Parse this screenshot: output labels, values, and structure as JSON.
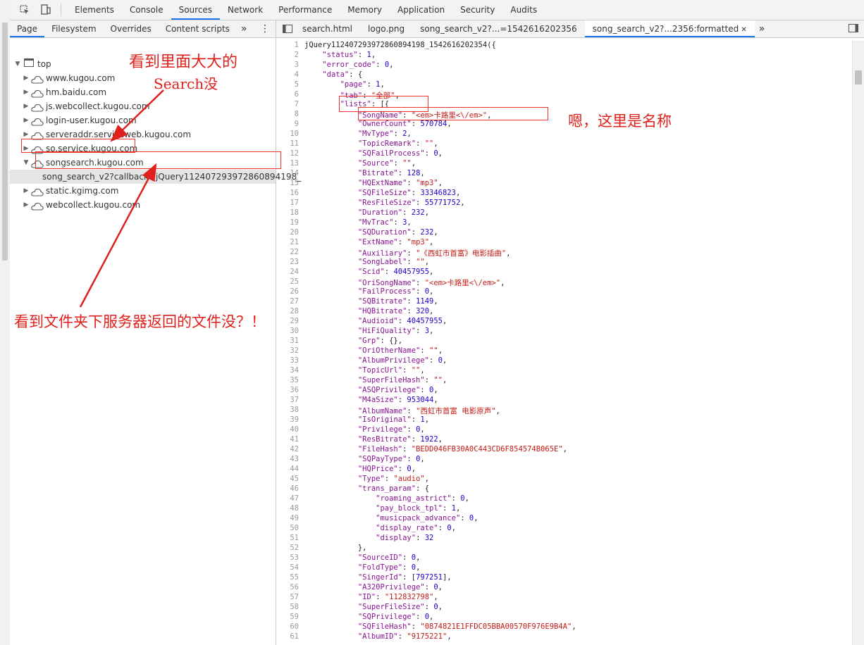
{
  "main_tabs": [
    "Elements",
    "Console",
    "Sources",
    "Network",
    "Performance",
    "Memory",
    "Application",
    "Security",
    "Audits"
  ],
  "main_tab_active": "Sources",
  "navigator": {
    "tabs": [
      "Page",
      "Filesystem",
      "Overrides",
      "Content scripts"
    ],
    "active": "Page",
    "more_glyph": "»",
    "menu_glyph": "⋮",
    "tree": [
      {
        "label": "top",
        "icon": "frame-icon",
        "expanded": true
      },
      {
        "label": "www.kugou.com",
        "icon": "cloud-icon"
      },
      {
        "label": "hm.baidu.com",
        "icon": "cloud-icon"
      },
      {
        "label": "js.webcollect.kugou.com",
        "icon": "cloud-icon"
      },
      {
        "label": "login-user.kugou.com",
        "icon": "cloud-icon"
      },
      {
        "label": "serveraddr.serviceweb.kugou.com",
        "icon": "cloud-icon"
      },
      {
        "label": "so.service.kugou.com",
        "icon": "cloud-icon"
      },
      {
        "label": "songsearch.kugou.com",
        "icon": "cloud-icon",
        "expanded": true
      },
      {
        "label": "song_search_v2?callback=jQuery112407293972860894198_",
        "icon": "folder-icon",
        "selected": true
      },
      {
        "label": "static.kgimg.com",
        "icon": "cloud-icon"
      },
      {
        "label": "webcollect.kugou.com",
        "icon": "cloud-icon"
      }
    ]
  },
  "editor_tabs": [
    "search.html",
    "logo.png",
    "song_search_v2?...=1542616202356",
    "song_search_v2?...2356:formatted"
  ],
  "editor_active": "song_search_v2?...2356:formatted",
  "code_lines": [
    "jQuery112407293972860894198_1542616202354({",
    "    \"status\": 1,",
    "    \"error_code\": 0,",
    "    \"data\": {",
    "        \"page\": 1,",
    "        \"tab\": \"全部\",",
    "        \"lists\": [{",
    "            \"SongName\": \"<em>卡路里<\\/em>\",",
    "            \"OwnerCount\": 570784,",
    "            \"MvType\": 2,",
    "            \"TopicRemark\": \"\",",
    "            \"SQFailProcess\": 0,",
    "            \"Source\": \"\",",
    "            \"Bitrate\": 128,",
    "            \"HQExtName\": \"mp3\",",
    "            \"SQFileSize\": 33346823,",
    "            \"ResFileSize\": 55771752,",
    "            \"Duration\": 232,",
    "            \"MvTrac\": 3,",
    "            \"SQDuration\": 232,",
    "            \"ExtName\": \"mp3\",",
    "            \"Auxiliary\": \"《西虹市首富》电影插曲\",",
    "            \"SongLabel\": \"\",",
    "            \"Scid\": 40457955,",
    "            \"OriSongName\": \"<em>卡路里<\\/em>\",",
    "            \"FailProcess\": 0,",
    "            \"SQBitrate\": 1149,",
    "            \"HQBitrate\": 320,",
    "            \"Audioid\": 40457955,",
    "            \"HiFiQuality\": 3,",
    "            \"Grp\": {},",
    "            \"OriOtherName\": \"\",",
    "            \"AlbumPrivilege\": 0,",
    "            \"TopicUrl\": \"\",",
    "            \"SuperFileHash\": \"\",",
    "            \"ASQPrivilege\": 0,",
    "            \"M4aSize\": 953044,",
    "            \"AlbumName\": \"西虹市首富 电影原声\",",
    "            \"IsOriginal\": 1,",
    "            \"Privilege\": 0,",
    "            \"ResBitrate\": 1922,",
    "            \"FileHash\": \"BEDD046FB30A0C443CD6F854574B065E\",",
    "            \"SQPayType\": 0,",
    "            \"HQPrice\": 0,",
    "            \"Type\": \"audio\",",
    "            \"trans_param\": {",
    "                \"roaming_astrict\": 0,",
    "                \"pay_block_tpl\": 1,",
    "                \"musicpack_advance\": 0,",
    "                \"display_rate\": 0,",
    "                \"display\": 32",
    "            },",
    "            \"SourceID\": 0,",
    "            \"FoldType\": 0,",
    "            \"SingerId\": [797251],",
    "            \"A320Privilege\": 0,",
    "            \"ID\": \"112832798\",",
    "            \"SuperFileSize\": 0,",
    "            \"SQPrivilege\": 0,",
    "            \"SQFileHash\": \"0874821E1FFDC05BBA00570F976E9B4A\",",
    "            \"AlbumID\": \"9175221\","
  ],
  "annotations": {
    "search_line1": "看到里面大大的",
    "search_line2": "Search没",
    "name_note": "嗯，这里是名称",
    "file_note": "看到文件夹下服务器返回的文件没？！"
  },
  "annotation_color": "#e0201c"
}
